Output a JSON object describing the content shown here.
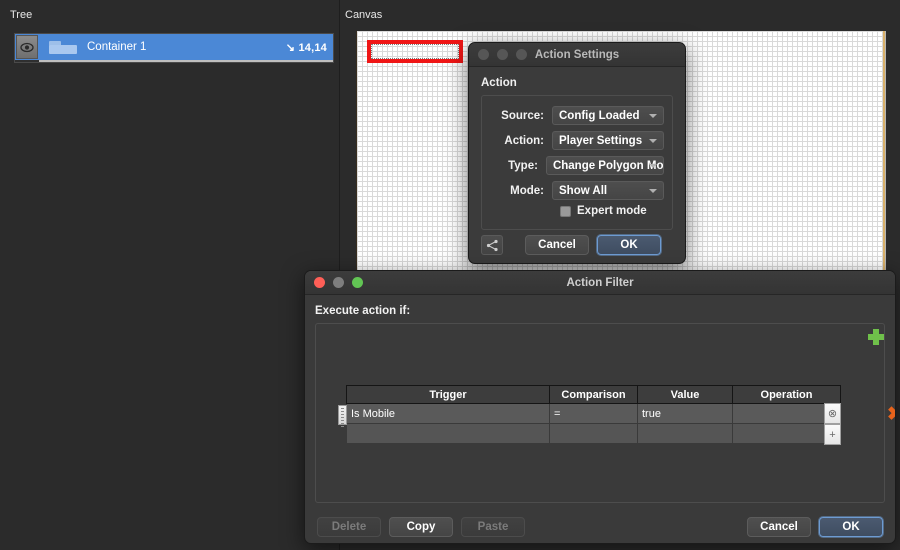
{
  "panels": {
    "tree_label": "Tree",
    "canvas_label": "Canvas"
  },
  "tree": {
    "item": {
      "eye_icon": "eye-icon",
      "container_icon": "container-icon",
      "label": "Container 1",
      "coords": "↘ 14,14"
    }
  },
  "canvas": {
    "selection": "red-selection-rectangle"
  },
  "action_settings": {
    "title": "Action Settings",
    "section_title": "Action",
    "fields": [
      {
        "label": "Source:",
        "value": "Config Loaded"
      },
      {
        "label": "Action:",
        "value": "Player Settings"
      },
      {
        "label": "Type:",
        "value": "Change Polygon Mode"
      },
      {
        "label": "Mode:",
        "value": "Show All"
      }
    ],
    "expert_mode_label": "Expert mode",
    "expert_mode_checked": false,
    "share_icon": "share-node-icon",
    "cancel_label": "Cancel",
    "ok_label": "OK"
  },
  "action_filter": {
    "title": "Action Filter",
    "exec_label": "Execute action if:",
    "add_icon": "plus-icon",
    "delete_icon": "x-icon",
    "columns": [
      "Trigger",
      "Comparison",
      "Value",
      "Operation"
    ],
    "rows": [
      {
        "trigger": "Is Mobile",
        "comparison": "=",
        "value": "true",
        "operation": ""
      },
      {
        "trigger": "",
        "comparison": "",
        "value": "",
        "operation": ""
      }
    ],
    "row_remove_icon": "⊗",
    "row_add_icon": "+",
    "footer": {
      "delete_label": "Delete",
      "copy_label": "Copy",
      "paste_label": "Paste",
      "cancel_label": "Cancel",
      "ok_label": "OK"
    }
  },
  "colors": {
    "selection_red": "#f01616",
    "accent_blue": "#4b88d6",
    "add_green": "#6fc04a",
    "delete_orange": "#e8631c"
  }
}
